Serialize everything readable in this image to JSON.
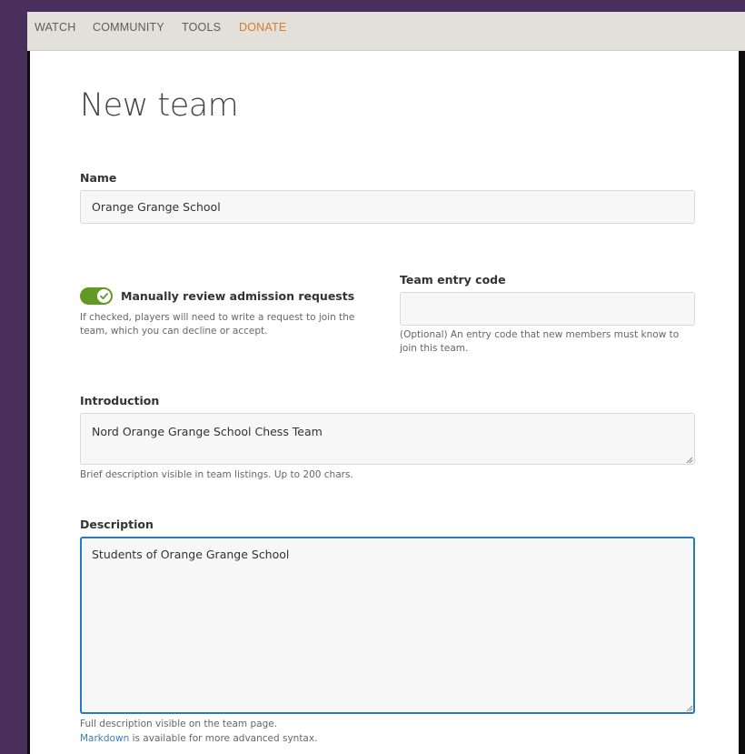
{
  "nav": {
    "items": [
      "WATCH",
      "COMMUNITY",
      "TOOLS",
      "DONATE"
    ]
  },
  "page": {
    "title": "New team"
  },
  "form": {
    "name": {
      "label": "Name",
      "value": "Orange Grange School"
    },
    "admission": {
      "label": "Manually review admission requests",
      "checked": true,
      "help": "If checked, players will need to write a request to join the team, which you can decline or accept."
    },
    "entry_code": {
      "label": "Team entry code",
      "value": "",
      "help": "(Optional) An entry code that new members must know to join this team."
    },
    "introduction": {
      "label": "Introduction",
      "value": "Nord Orange Grange School Chess Team",
      "help": "Brief description visible in team listings. Up to 200 chars."
    },
    "description": {
      "label": "Description",
      "value": "Students of Orange Grange School",
      "help": "Full description visible on the team page.",
      "markdown_link": "Markdown",
      "markdown_suffix": " is available for more advanced syntax."
    }
  },
  "colors": {
    "toggle_on": "#629924",
    "accent_orange": "#d87a2a",
    "focus_blue": "#2b79c2",
    "link_blue": "#3b7dc4"
  }
}
